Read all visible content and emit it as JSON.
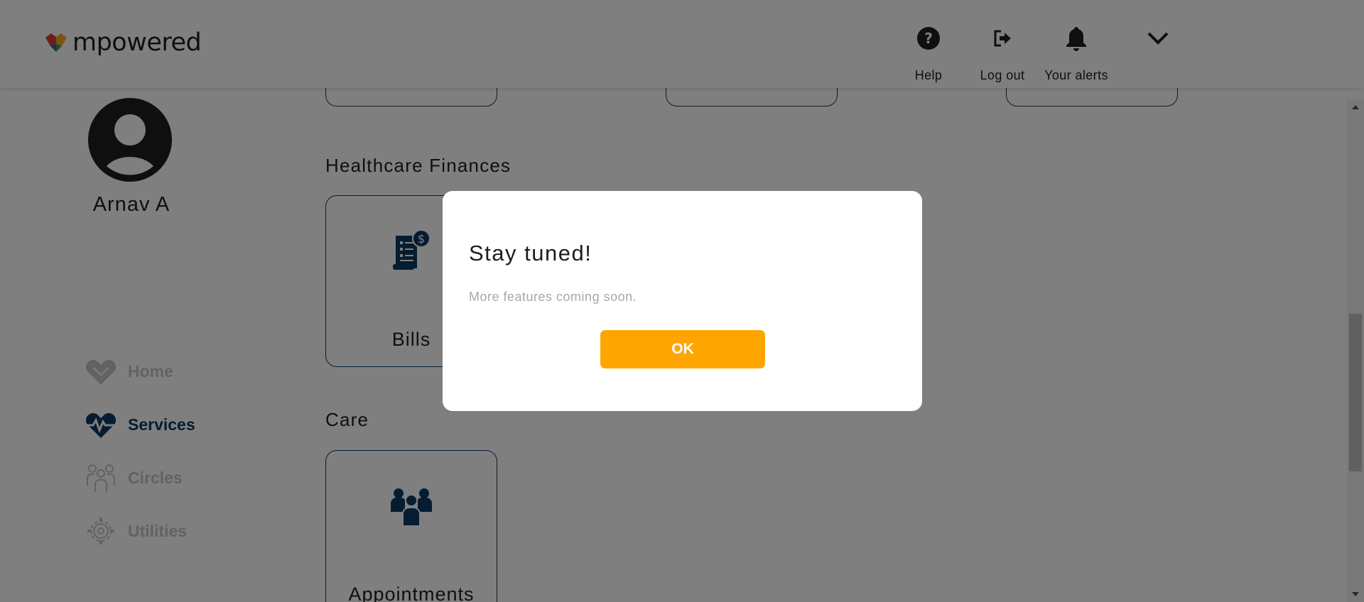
{
  "header": {
    "brand": "mpowered",
    "actions": [
      {
        "id": "help",
        "label": "Help",
        "icon": "help-circle-icon"
      },
      {
        "id": "logout",
        "label": "Log out",
        "icon": "logout-icon"
      },
      {
        "id": "alerts",
        "label": "Your alerts",
        "icon": "bell-icon"
      }
    ],
    "menu_icon": "chevron-down-icon"
  },
  "user": {
    "name": "Arnav A",
    "avatar_icon": "user-avatar-icon"
  },
  "nav": {
    "items": [
      {
        "label": "Home",
        "icon": "heart-home-icon",
        "active": false
      },
      {
        "label": "Services",
        "icon": "heartbeat-icon",
        "active": true
      },
      {
        "label": "Circles",
        "icon": "people-icon",
        "active": false
      },
      {
        "label": "Utilities",
        "icon": "gear-icon",
        "active": false
      }
    ]
  },
  "sections": [
    {
      "title": "Healthcare Finances",
      "cards": [
        {
          "label": "Bills",
          "icon": "bill-dollar-icon"
        }
      ]
    },
    {
      "title": "Care",
      "cards": [
        {
          "label": "Appointments",
          "icon": "group-people-icon"
        }
      ]
    }
  ],
  "modal": {
    "title": "Stay tuned!",
    "message": "More features coming soon.",
    "ok_label": "OK"
  },
  "colors": {
    "navy": "#0c3a62",
    "accent": "#ffa500",
    "inactive_nav": "#c4c4c4",
    "overlay": "rgba(0,0,0,0.5)"
  }
}
